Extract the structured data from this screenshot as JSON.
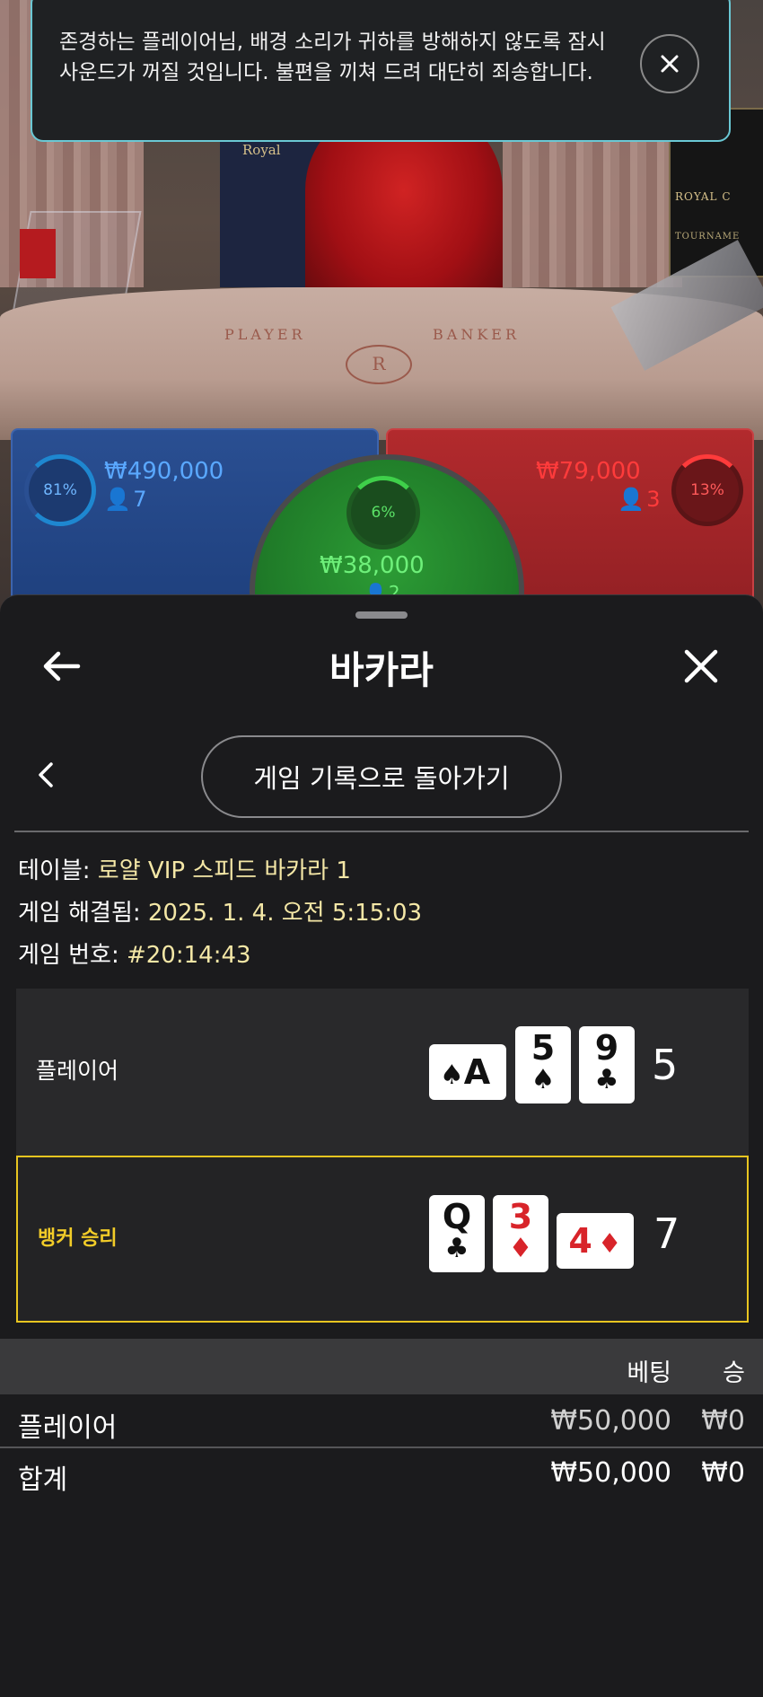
{
  "toast": {
    "message": "존경하는 플레이어님, 배경 소리가 귀하를 방해하지 않도록 잠시 사운드가 꺼질 것입니다. 불편을 끼쳐 드려 대단히 죄송합니다.",
    "close_icon": "close-icon"
  },
  "scene": {
    "royal_sign": "Royal",
    "plaque_title": "ROYAL C",
    "plaque_sub": "TOURNAME",
    "table_player": "PLAYER",
    "table_banker": "BANKER",
    "table_logo": "R"
  },
  "bets": {
    "player": {
      "percent": "81%",
      "amount": "₩490,000",
      "count": "7"
    },
    "banker": {
      "percent": "13%",
      "amount": "₩79,000",
      "count": "3"
    },
    "tie": {
      "percent": "6%",
      "amount": "₩38,000",
      "count": "2"
    }
  },
  "sheet": {
    "title": "바카라",
    "back_icon": "arrow-left-icon",
    "close_icon": "close-icon",
    "nav_back_icon": "chevron-left-icon",
    "return_button": "게임 기록으로 돌아가기"
  },
  "details": {
    "table_label": "테이블: ",
    "table_value": "로얄 VIP 스피드 바카라 1",
    "resolved_label": "게임 해결됨: ",
    "resolved_value": "2025. 1. 4. 오전 5:15:03",
    "number_label": "게임 번호: ",
    "number_value": "#20:14:43"
  },
  "hands": {
    "player": {
      "label": "플레이어",
      "score": "5",
      "cards": [
        {
          "rank": "A",
          "suit": "♠",
          "color": "#111111",
          "orientation": "horizontal"
        },
        {
          "rank": "5",
          "suit": "♠",
          "color": "#111111",
          "orientation": "vertical"
        },
        {
          "rank": "9",
          "suit": "♣",
          "color": "#111111",
          "orientation": "vertical"
        }
      ]
    },
    "banker": {
      "label": "뱅커 승리",
      "score": "7",
      "cards": [
        {
          "rank": "Q",
          "suit": "♣",
          "color": "#111111",
          "orientation": "vertical"
        },
        {
          "rank": "3",
          "suit": "♦",
          "color": "#d8242a",
          "orientation": "vertical"
        },
        {
          "rank": "4",
          "suit": "♦",
          "color": "#d8242a",
          "orientation": "horizontal"
        }
      ]
    }
  },
  "bets_table": {
    "headers": {
      "bet": "베팅",
      "win": "승"
    },
    "rows": [
      {
        "name": "플레이어",
        "bet": "₩50,000",
        "win": "₩0"
      },
      {
        "name": "합계",
        "bet": "₩50,000",
        "win": "₩0"
      }
    ]
  },
  "colors": {
    "accent_yellow": "#e8c520",
    "player_blue": "#1d3e7b",
    "banker_red": "#8f1f23",
    "tie_green": "#1f7a28",
    "toast_border": "#6ac8d4"
  }
}
